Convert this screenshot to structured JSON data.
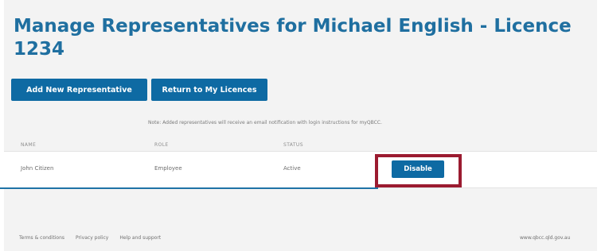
{
  "page": {
    "title": "Manage Representatives for Michael English - Licence 1234"
  },
  "actions": {
    "add_label": "Add New Representative",
    "return_label": "Return to My Licences"
  },
  "note": "Note: Added representatives will receive an email notification with login instructions for myQBCC.",
  "table": {
    "columns": [
      "NAME",
      "ROLE",
      "STATUS"
    ],
    "rows": [
      {
        "name": "John Citizen",
        "role": "Employee",
        "status": "Active",
        "action_label": "Disable"
      }
    ]
  },
  "footer": {
    "links": [
      "Terms & conditions",
      "Privacy policy",
      "Help and support"
    ],
    "site": "www.qbcc.qld.gov.au"
  },
  "colors": {
    "accent": "#0e6aa3",
    "title": "#1f6fa0",
    "highlight": "#9b1b30",
    "callout": "#1f73a6"
  }
}
